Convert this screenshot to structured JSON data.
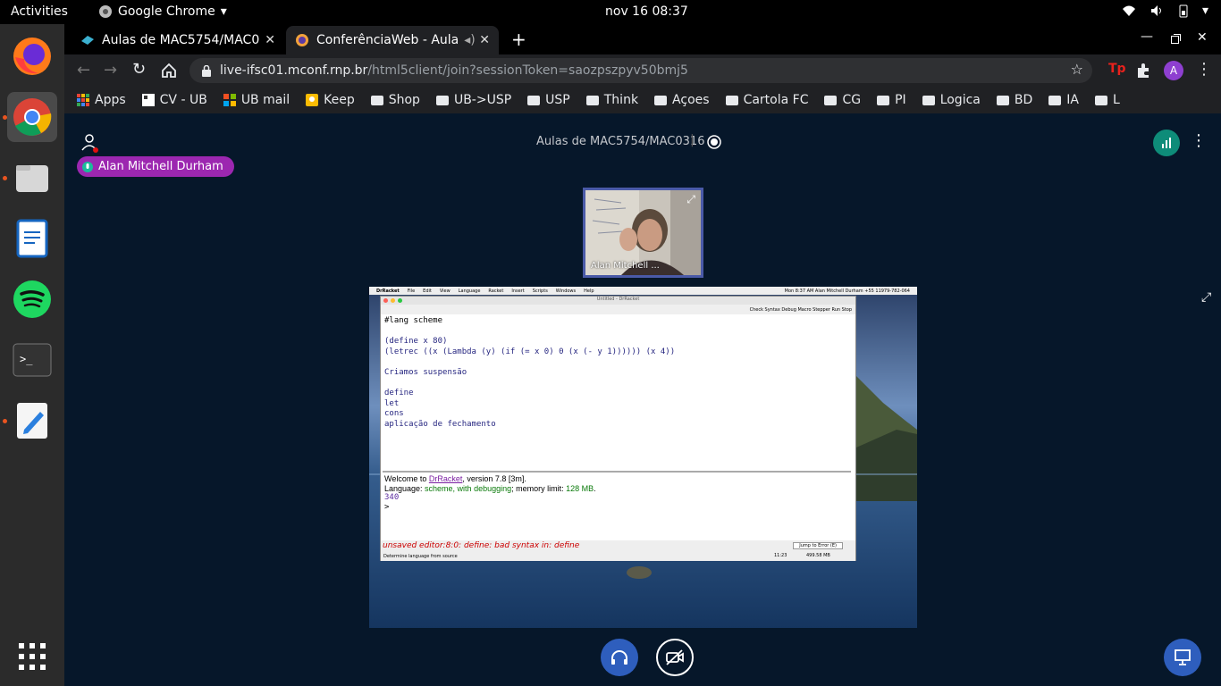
{
  "system": {
    "activities": "Activities",
    "app_name": "Google Chrome",
    "clock": "nov 16  08:37"
  },
  "tabs": [
    {
      "title": "Aulas de MAC5754/MAC0"
    },
    {
      "title": "ConferênciaWeb - Aula"
    }
  ],
  "address": {
    "host": "live-ifsc01.mconf.rnp.br",
    "path": "/html5client/join?sessionToken=saozpszpyv50bmj5"
  },
  "profile_initial": "A",
  "bookmarks": [
    "Apps",
    "CV - UB",
    "UB mail",
    "Keep",
    "Shop",
    "UB->USP",
    "USP",
    "Think",
    "Açoes",
    "Cartola FC",
    "CG",
    "PI",
    "Logica",
    "BD",
    "IA",
    "L"
  ],
  "meeting": {
    "title": "Aulas de MAC5754/MAC0316",
    "talker": "Alan Mitchell Durham",
    "webcam_name": "Alan Mitchell ..."
  },
  "drracket": {
    "menubar": [
      "DrRacket",
      "File",
      "Edit",
      "View",
      "Language",
      "Racket",
      "Insert",
      "Scripts",
      "Windows",
      "Help"
    ],
    "menubar_right": "Mon 8:37 AM  Alan Mitchell Durham +55 11979-782-064",
    "window_title": "Untitled - DrRacket",
    "toolbar_right": "Check Syntax  Debug  Macro Stepper  Run  Stop",
    "editor_lines": [
      "#lang scheme",
      "",
      "(define x 80)",
      "(letrec ((x (Lambda (y) (if (= x 0) 0 (x (- y 1)))))) (x 4))",
      "",
      " Criamos suspensão",
      "",
      "define",
      "let",
      "cons",
      "aplicação de fechamento"
    ],
    "repl": {
      "welcome_prefix": "Welcome to ",
      "welcome_link": "DrRacket",
      "welcome_suffix": ", version 7.8 [3m].",
      "language_prefix": "Language: ",
      "language_name": "scheme, with debugging",
      "language_mid": "; memory limit: ",
      "memory": "128 MB",
      "language_end": ".",
      "result": "340",
      "prompt": ">"
    },
    "error": "unsaved editor:8:0: define: bad syntax in: define",
    "jump": "Jump to Error (E)",
    "lang_chooser": "Determine language from source",
    "position": "11:23",
    "mem_usage": "499.58 MB"
  },
  "colors": {
    "page_bg": "#06172a",
    "talker_bg": "#9c27b0",
    "control_blue": "#2e5ebd",
    "stats_bg": "#0e8c79"
  }
}
